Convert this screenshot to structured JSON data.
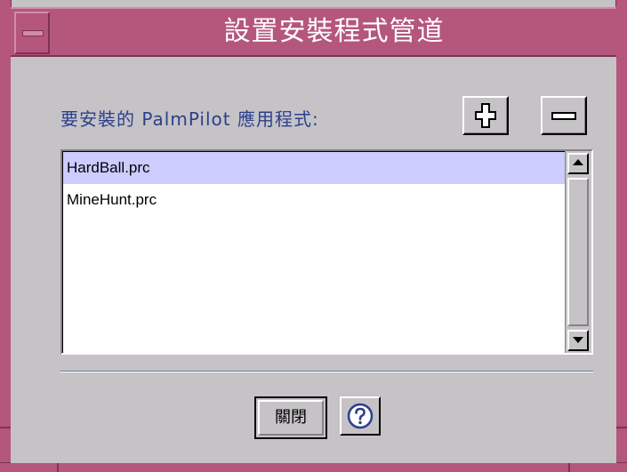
{
  "window": {
    "title": "設置安裝程式管道"
  },
  "main": {
    "list_label": "要安裝的 PalmPilot 應用程式:",
    "files": [
      {
        "name": "HardBall.prc",
        "selected": true
      },
      {
        "name": "MineHunt.prc",
        "selected": false
      }
    ]
  },
  "buttons": {
    "close_label": "關閉"
  },
  "icons": {
    "add": "plus-icon",
    "remove": "minus-icon",
    "help": "question-icon",
    "window_menu": "window-menu-icon",
    "scroll_up": "arrow-up-icon",
    "scroll_down": "arrow-down-icon"
  },
  "colors": {
    "titlebar": "#b5567c",
    "background": "#c6c3c6",
    "label": "#2c3f8c",
    "selection": "#ccccff",
    "help_icon": "#2c3f8c"
  }
}
